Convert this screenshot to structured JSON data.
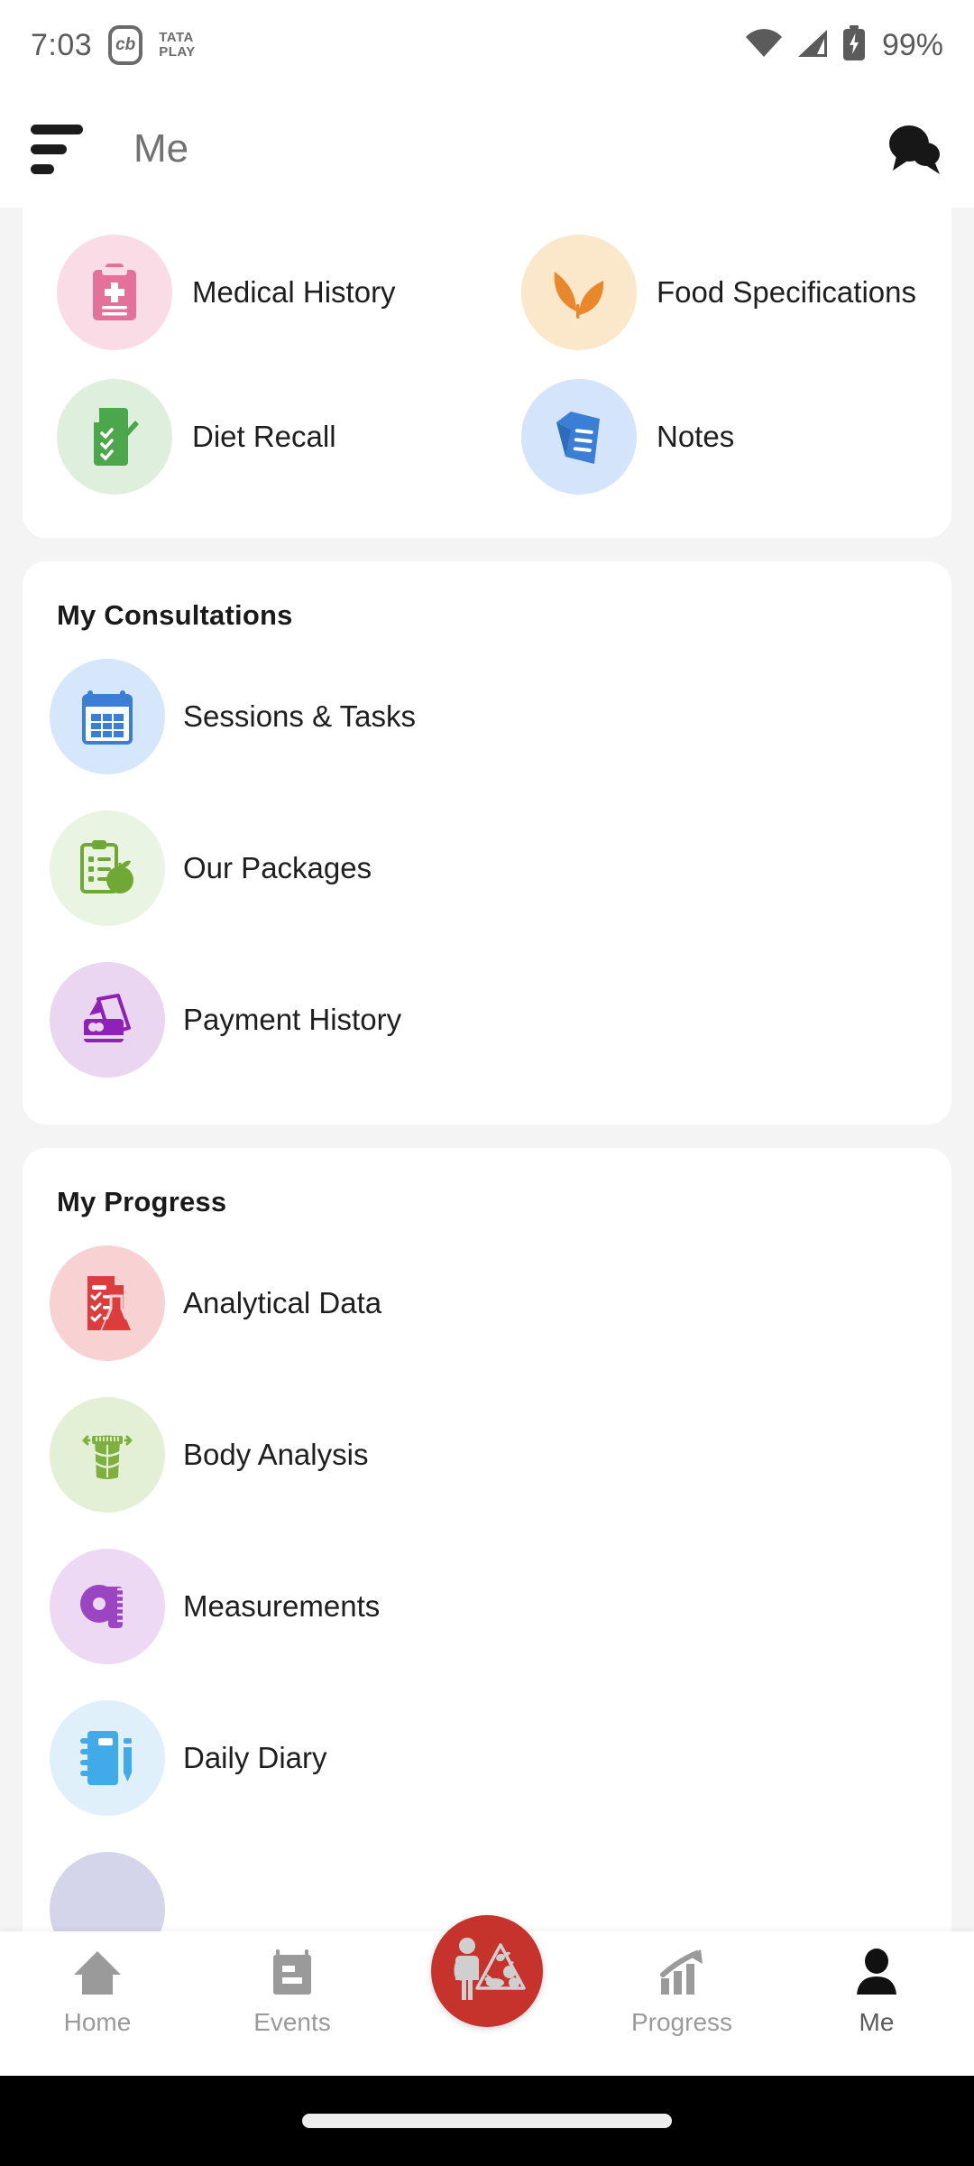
{
  "status_bar": {
    "time": "7:03",
    "app_badge": "cb",
    "carrier_line1": "TATA",
    "carrier_line2": "PLAY",
    "battery_percent": "99%",
    "icons": [
      "wifi-icon",
      "cellular-signal-icon",
      "battery-charging-icon"
    ]
  },
  "app_bar": {
    "menu_icon": "hamburger-menu-icon",
    "title": "Me",
    "chat_icon": "chat-bubbles-icon"
  },
  "cards": [
    {
      "id": "my-details",
      "title": "",
      "layout": "grid",
      "rows": [
        [
          {
            "label": "Medical History",
            "icon": "medical-clipboard-icon",
            "bg": "#FADCE6",
            "fg": "#E4719A"
          },
          {
            "label": "Food Specifications",
            "icon": "leaf-sprout-icon",
            "bg": "#FBE7C9",
            "fg": "#E8872B"
          }
        ],
        [
          {
            "label": "Diet Recall",
            "icon": "checklist-pen-icon",
            "bg": "#DEF0DD",
            "fg": "#4CA64C"
          },
          {
            "label": "Notes",
            "icon": "notes-document-icon",
            "bg": "#D4E4FA",
            "fg": "#3A7FD5"
          }
        ]
      ]
    },
    {
      "id": "my-consultations",
      "title": "My Consultations",
      "layout": "list",
      "items": [
        {
          "label": "Sessions & Tasks",
          "icon": "calendar-icon",
          "bg": "#D6E6FB",
          "fg": "#3A7FD5"
        },
        {
          "label": "Our Packages",
          "icon": "clipboard-apple-icon",
          "bg": "#EAF4E2",
          "fg": "#6FA834"
        },
        {
          "label": "Payment History",
          "icon": "card-swipe-icon",
          "bg": "#EBD6F2",
          "fg": "#9021B8"
        }
      ]
    },
    {
      "id": "my-progress",
      "title": "My Progress",
      "layout": "list",
      "items": [
        {
          "label": "Analytical Data",
          "icon": "lab-flask-report-icon",
          "bg": "#F8D2D2",
          "fg": "#DC3C3C"
        },
        {
          "label": "Body Analysis",
          "icon": "waist-measure-icon",
          "bg": "#E3F0D5",
          "fg": "#7FB03F"
        },
        {
          "label": "Measurements",
          "icon": "tape-measure-icon",
          "bg": "#EDD9F3",
          "fg": "#9B45C2"
        },
        {
          "label": "Daily Diary",
          "icon": "notebook-pencil-icon",
          "bg": "#DFF0FB",
          "fg": "#41AAE8"
        },
        {
          "label": "",
          "icon": "partial-lavender-circle-icon",
          "bg": "#D4D4EA",
          "fg": "#D4D4EA"
        }
      ]
    }
  ],
  "fab": {
    "icon": "nutritionist-food-pyramid-icon",
    "color": "#C5332C"
  },
  "bottom_nav": {
    "items": [
      {
        "label": "Home",
        "icon": "home-icon",
        "active": false
      },
      {
        "label": "Events",
        "icon": "events-calendar-icon",
        "active": false
      },
      {
        "label": "",
        "icon": "fab-spacer",
        "active": false
      },
      {
        "label": "Progress",
        "icon": "progress-chart-icon",
        "active": false
      },
      {
        "label": "Me",
        "icon": "person-icon",
        "active": true
      }
    ]
  },
  "colors": {
    "page_background": "#F4F4F4",
    "card_background": "#FFFFFF",
    "accent_red": "#C5332C",
    "text_primary": "#1E1E1E",
    "text_muted": "#9A9A9A"
  }
}
